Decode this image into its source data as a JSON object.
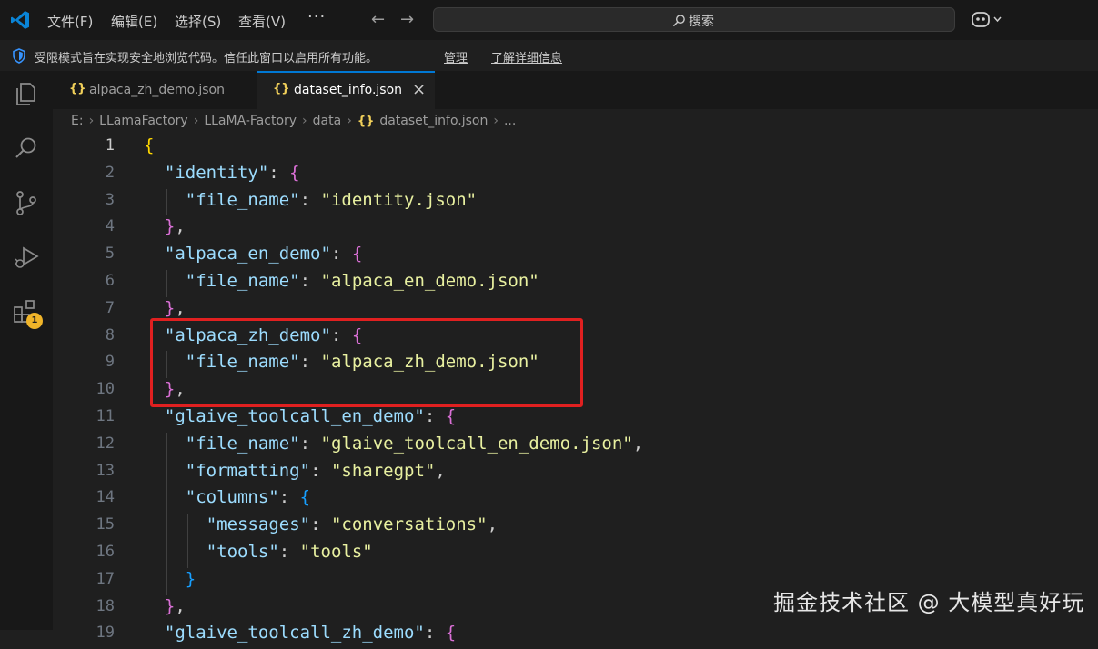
{
  "titlebar": {
    "menus": [
      "文件(F)",
      "编辑(E)",
      "选择(S)",
      "查看(V)"
    ],
    "more": "···",
    "search_placeholder": "搜索"
  },
  "banner": {
    "message": "受限模式旨在实现安全地浏览代码。信任此窗口以启用所有功能。",
    "manage": "管理",
    "learn_more": "了解详细信息"
  },
  "activity": {
    "extensions_badge": "1"
  },
  "tabs": [
    {
      "label": "alpaca_zh_demo.json",
      "icon": "{}"
    },
    {
      "label": "dataset_info.json",
      "icon": "{}",
      "close": "×"
    }
  ],
  "breadcrumb": {
    "items": [
      "E:",
      "LLamaFactory",
      "LLaMA-Factory",
      "data"
    ],
    "file_icon": "{}",
    "file": "dataset_info.json",
    "ellipsis": "..."
  },
  "editor": {
    "lines": [
      {
        "n": "1",
        "indent": 0,
        "tokens": [
          [
            "{",
            "b1"
          ]
        ]
      },
      {
        "n": "2",
        "indent": 1,
        "tokens": [
          [
            "\"identity\"",
            "k"
          ],
          [
            ": ",
            ""
          ],
          [
            "{",
            "b2"
          ]
        ]
      },
      {
        "n": "3",
        "indent": 2,
        "tokens": [
          [
            "\"file_name\"",
            "k"
          ],
          [
            ": ",
            ""
          ],
          [
            "\"identity.json\"",
            "sv"
          ]
        ]
      },
      {
        "n": "4",
        "indent": 1,
        "tokens": [
          [
            "}",
            "b2"
          ],
          [
            ",",
            ""
          ]
        ]
      },
      {
        "n": "5",
        "indent": 1,
        "tokens": [
          [
            "\"alpaca_en_demo\"",
            "k"
          ],
          [
            ": ",
            ""
          ],
          [
            "{",
            "b2"
          ]
        ]
      },
      {
        "n": "6",
        "indent": 2,
        "tokens": [
          [
            "\"file_name\"",
            "k"
          ],
          [
            ": ",
            ""
          ],
          [
            "\"alpaca_en_demo.json\"",
            "sv"
          ]
        ]
      },
      {
        "n": "7",
        "indent": 1,
        "tokens": [
          [
            "}",
            "b2"
          ],
          [
            ",",
            ""
          ]
        ]
      },
      {
        "n": "8",
        "indent": 1,
        "tokens": [
          [
            "\"alpaca_zh_demo\"",
            "k"
          ],
          [
            ": ",
            ""
          ],
          [
            "{",
            "b2"
          ]
        ]
      },
      {
        "n": "9",
        "indent": 2,
        "tokens": [
          [
            "\"file_name\"",
            "k"
          ],
          [
            ": ",
            ""
          ],
          [
            "\"alpaca_zh_demo.json\"",
            "sv"
          ]
        ]
      },
      {
        "n": "10",
        "indent": 1,
        "tokens": [
          [
            "}",
            "b2"
          ],
          [
            ",",
            ""
          ]
        ]
      },
      {
        "n": "11",
        "indent": 1,
        "tokens": [
          [
            "\"glaive_toolcall_en_demo\"",
            "k"
          ],
          [
            ": ",
            ""
          ],
          [
            "{",
            "b2"
          ]
        ]
      },
      {
        "n": "12",
        "indent": 2,
        "tokens": [
          [
            "\"file_name\"",
            "k"
          ],
          [
            ": ",
            ""
          ],
          [
            "\"glaive_toolcall_en_demo.json\"",
            "sv"
          ],
          [
            ",",
            ""
          ]
        ]
      },
      {
        "n": "13",
        "indent": 2,
        "tokens": [
          [
            "\"formatting\"",
            "k"
          ],
          [
            ": ",
            ""
          ],
          [
            "\"sharegpt\"",
            "sv"
          ],
          [
            ",",
            ""
          ]
        ]
      },
      {
        "n": "14",
        "indent": 2,
        "tokens": [
          [
            "\"columns\"",
            "k"
          ],
          [
            ": ",
            ""
          ],
          [
            "{",
            "b3"
          ]
        ]
      },
      {
        "n": "15",
        "indent": 3,
        "tokens": [
          [
            "\"messages\"",
            "k"
          ],
          [
            ": ",
            ""
          ],
          [
            "\"conversations\"",
            "sv"
          ],
          [
            ",",
            ""
          ]
        ]
      },
      {
        "n": "16",
        "indent": 3,
        "tokens": [
          [
            "\"tools\"",
            "k"
          ],
          [
            ": ",
            ""
          ],
          [
            "\"tools\"",
            "sv"
          ]
        ]
      },
      {
        "n": "17",
        "indent": 2,
        "tokens": [
          [
            "}",
            "b3"
          ]
        ]
      },
      {
        "n": "18",
        "indent": 1,
        "tokens": [
          [
            "}",
            "b2"
          ],
          [
            ",",
            ""
          ]
        ]
      },
      {
        "n": "19",
        "indent": 1,
        "tokens": [
          [
            "\"glaive_toolcall_zh_demo\"",
            "k"
          ],
          [
            ": ",
            ""
          ],
          [
            "{",
            "b2"
          ]
        ]
      }
    ]
  },
  "watermark": "掘金技术社区 @ 大模型真好玩"
}
